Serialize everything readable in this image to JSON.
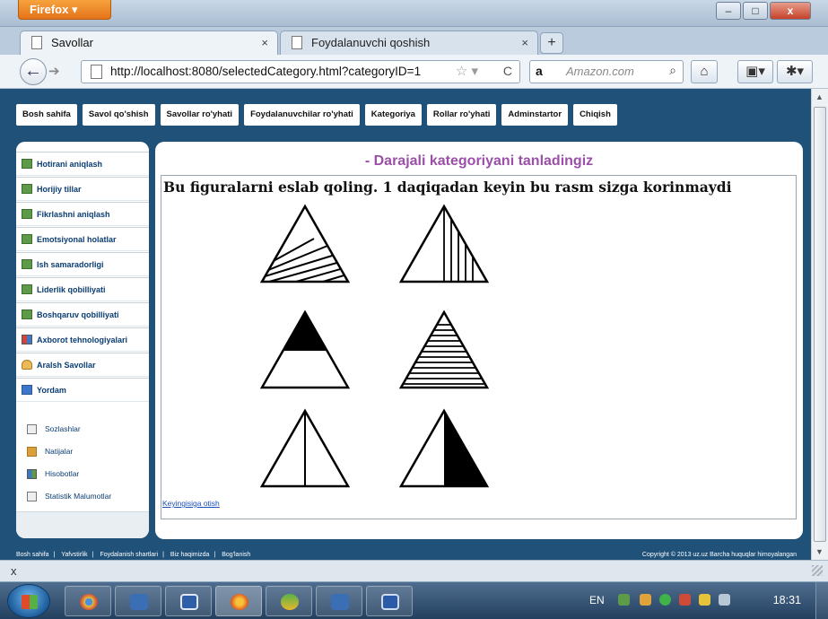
{
  "browser": {
    "menu_label": "Firefox ▾",
    "window_controls": {
      "minimize": "–",
      "maximize": "□",
      "close": "x"
    },
    "tabs": [
      {
        "label": "Savollar",
        "active": true
      },
      {
        "label": "Foydalanuvchi qoshish",
        "active": false
      }
    ],
    "url": "http://localhost:8080/selectedCategory.html?categoryID=1",
    "search_engine": "a",
    "search_placeholder": "Amazon.com"
  },
  "page": {
    "top_menu": [
      "Bosh sahifa",
      "Savol qo'shish",
      "Savollar ro'yhati",
      "Foydalanuvchilar ro'yhati",
      "Kategoriya",
      "Rollar ro'yhati",
      "Adminstartor",
      "Chiqish"
    ],
    "sidebar": {
      "categories": [
        {
          "label": "Hotirani aniqlash",
          "icon": "table-icon"
        },
        {
          "label": "Horijiy tillar",
          "icon": "table-icon"
        },
        {
          "label": "Fikrlashni aniqlash",
          "icon": "table-icon"
        },
        {
          "label": "Emotsiyonal holatlar",
          "icon": "table-icon"
        },
        {
          "label": "Ish samaradorligi",
          "icon": "table-icon"
        },
        {
          "label": "Liderlik qobilliyati",
          "icon": "table-icon"
        },
        {
          "label": "Boshqaruv qobilliyati",
          "icon": "table-icon"
        },
        {
          "label": "Axborot tehnologiyalari",
          "icon": "grid-icon"
        },
        {
          "label": "Aralsh Savollar",
          "icon": "person-icon"
        },
        {
          "label": "Yordam",
          "icon": "window-icon"
        }
      ],
      "tools": [
        {
          "label": "Sozlashlar",
          "icon": "settings-icon"
        },
        {
          "label": "Natijalar",
          "icon": "cube-icon"
        },
        {
          "label": "Hisobotlar",
          "icon": "report-icon"
        },
        {
          "label": "Statistik Malumotlar",
          "icon": "document-icon"
        }
      ]
    },
    "content_title": "- Darajali kategoriyani tanladingiz",
    "question": "Bu figuralarni eslab qoling. 1 daqiqadan keyin bu rasm sizga korinmaydi",
    "next_link": "Keyingisiga otish",
    "figures": [
      "triangle-diagonal-hatch-icon",
      "triangle-vertical-hatch-icon",
      "triangle-filled-top-icon",
      "triangle-horizontal-stripes-icon",
      "triangle-center-line-icon",
      "triangle-half-filled-icon"
    ],
    "footer": {
      "links": [
        "Bosh sahifa",
        "Yafvstirlik",
        "Foydalanish shartlari",
        "Biz haqimizda",
        "Bog'lanish"
      ],
      "copyright": "Copyright © 2013 uz.uz Barcha huquqlar himoyalangan"
    }
  },
  "findbar": {
    "close": "x"
  },
  "taskbar": {
    "language": "EN",
    "clock": "18:31"
  }
}
